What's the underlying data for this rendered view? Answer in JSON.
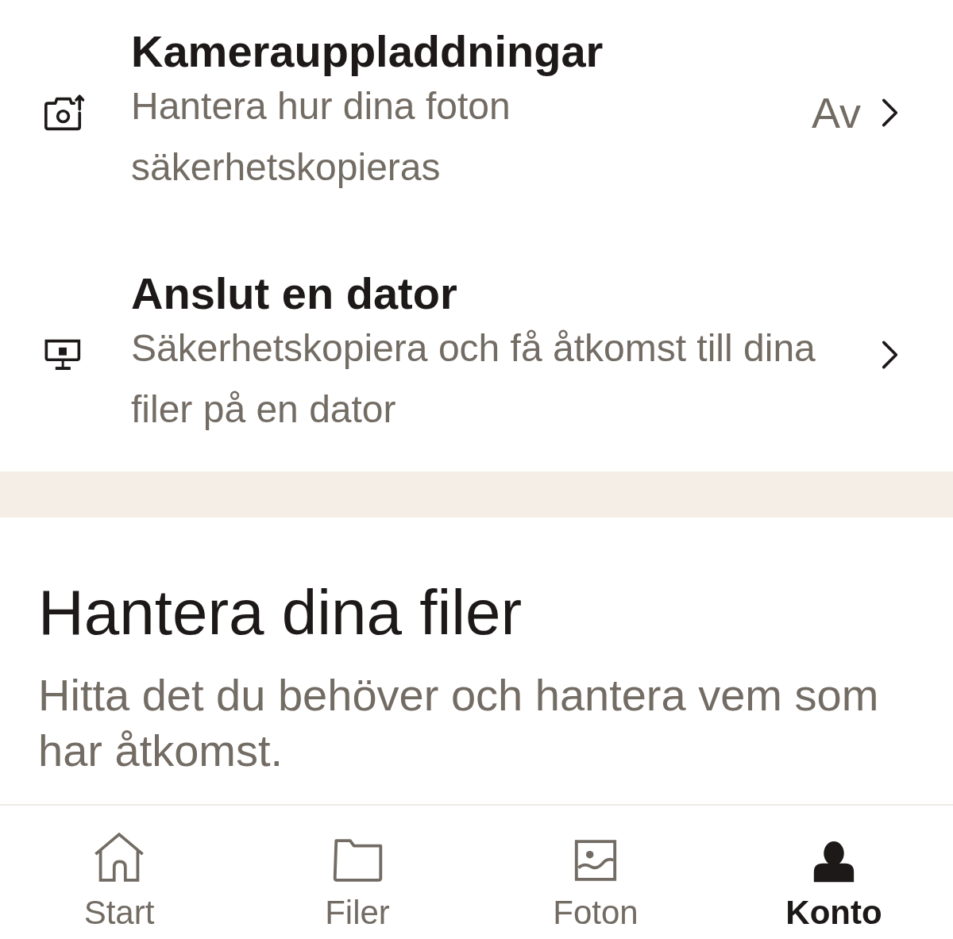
{
  "settings_items": [
    {
      "title": "Kamerauppladdningar",
      "subtitle": "Hantera hur dina foton säkerhetskopieras",
      "value": "Av"
    },
    {
      "title": "Anslut en dator",
      "subtitle": "Säkerhetskopiera och få åtkomst till dina filer på en dator"
    }
  ],
  "section": {
    "heading": "Hantera dina filer",
    "description": "Hitta det du behöver och hantera vem som har åtkomst."
  },
  "bottom_nav": [
    {
      "label": "Start",
      "selected": false
    },
    {
      "label": "Filer",
      "selected": false
    },
    {
      "label": "Foton",
      "selected": false
    },
    {
      "label": "Konto",
      "selected": true
    }
  ]
}
